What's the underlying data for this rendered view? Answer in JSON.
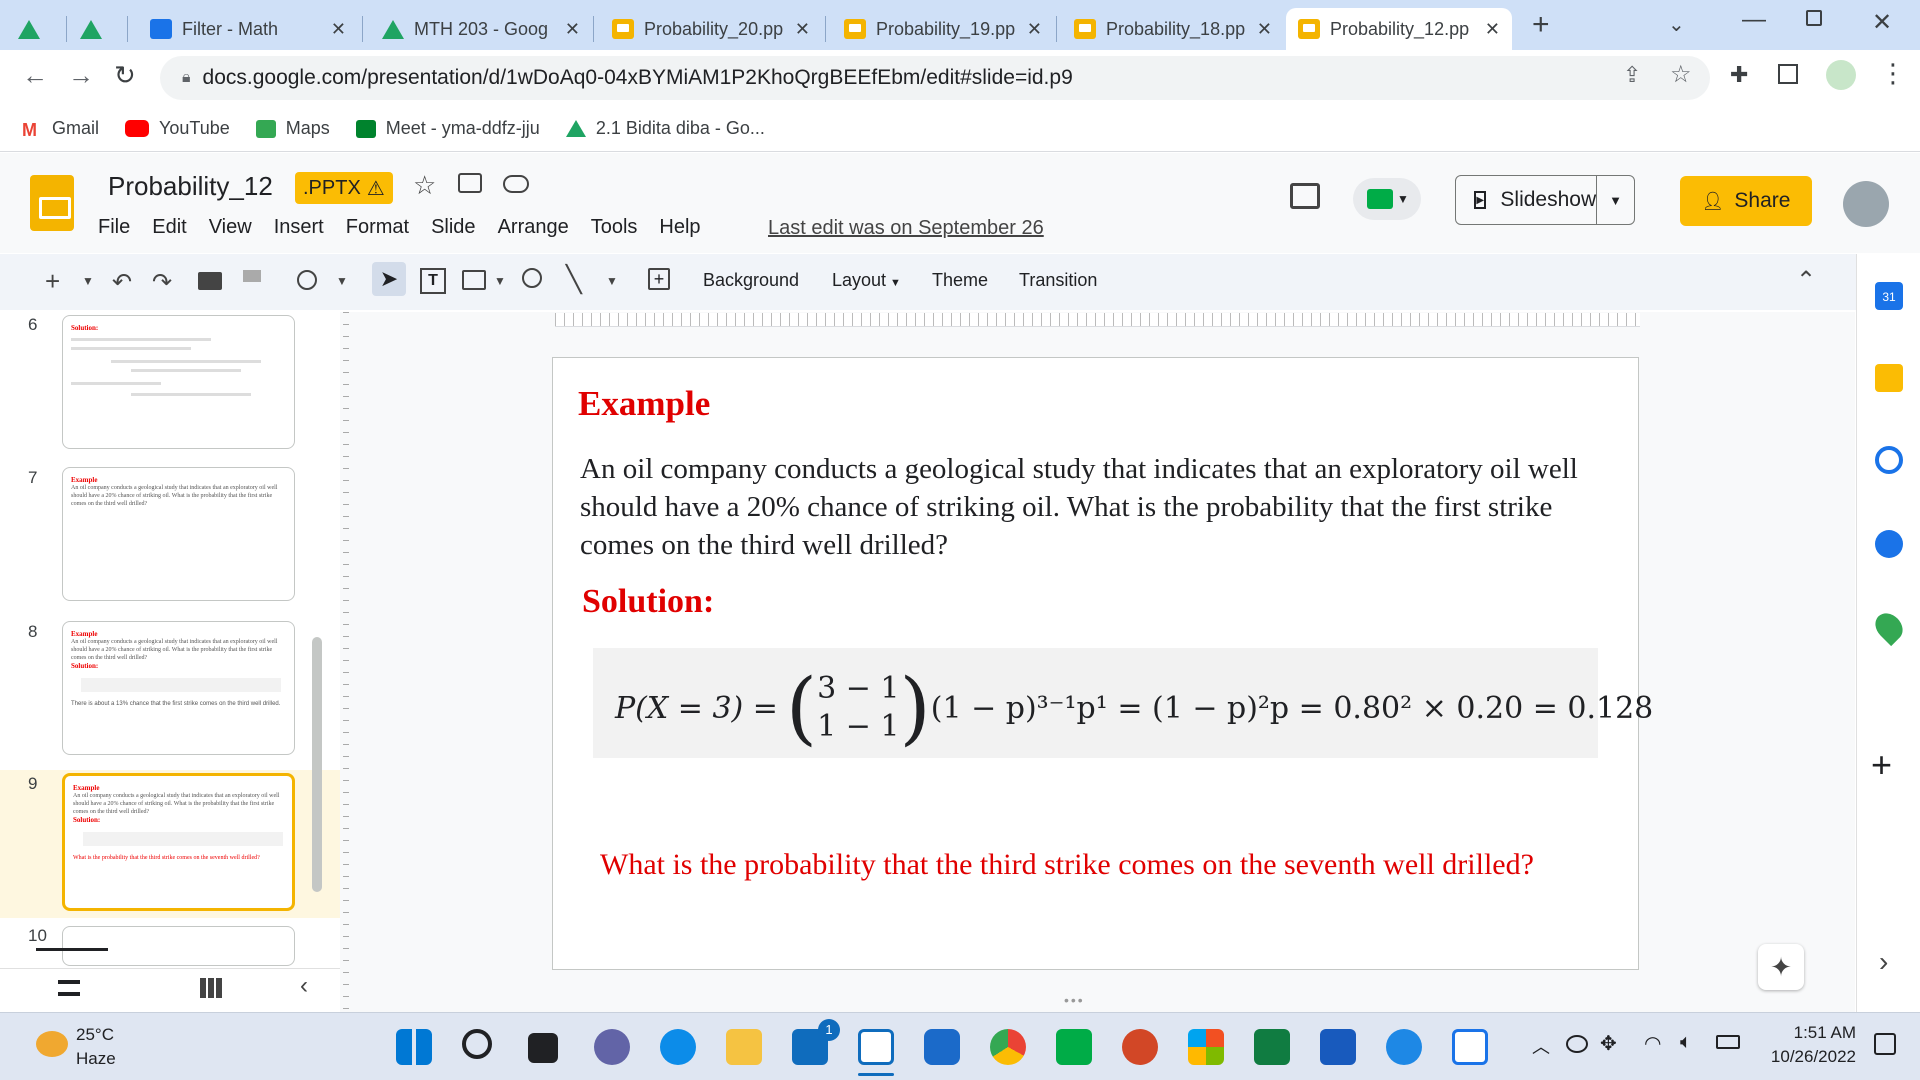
{
  "browser": {
    "tabs": [
      {
        "label": "",
        "icon": "drive-icon"
      },
      {
        "label": "",
        "icon": "drive-icon"
      },
      {
        "label": "Filter - Math",
        "icon": "classroom-icon"
      },
      {
        "label": "MTH 203 - Goog",
        "icon": "drive-icon"
      },
      {
        "label": "Probability_20.pp",
        "icon": "slides-icon"
      },
      {
        "label": "Probability_19.pp",
        "icon": "slides-icon"
      },
      {
        "label": "Probability_18.pp",
        "icon": "slides-icon"
      },
      {
        "label": "Probability_12.pp",
        "icon": "slides-icon"
      }
    ],
    "url": "docs.google.com/presentation/d/1wDoAq0-04xBYMiAM1P2KhoQrgBEEfEbm/edit#slide=id.p9",
    "bookmarks": [
      "Gmail",
      "YouTube",
      "Maps",
      "Meet - yma-ddfz-jju",
      "2.1 Bidita diba - Go..."
    ]
  },
  "doc": {
    "title": "Probability_12",
    "badge": ".PPTX",
    "menu": [
      "File",
      "Edit",
      "View",
      "Insert",
      "Format",
      "Slide",
      "Arrange",
      "Tools",
      "Help"
    ],
    "last_edit": "Last edit was on September 26",
    "slideshow_label": "Slideshow",
    "share_label": "Share"
  },
  "toolbar": {
    "background": "Background",
    "layout": "Layout",
    "theme": "Theme",
    "transition": "Transition"
  },
  "thumbnails": [
    {
      "num": "6",
      "heading": "Solution:",
      "text": ""
    },
    {
      "num": "7",
      "heading": "Example",
      "text": "An oil company conducts a geological study that indicates that an exploratory oil well should have a 20% chance of striking oil. What is the probability that the first strike comes on the third well drilled?"
    },
    {
      "num": "8",
      "heading": "Example",
      "text": "An oil company conducts a geological study that indicates that an exploratory oil well should have a 20% chance of striking oil. What is the probability that the first strike comes on the third well drilled?",
      "sol": "Solution:",
      "note": "There is about a 13% chance that the first strike comes on the third well drilled."
    },
    {
      "num": "9",
      "heading": "Example",
      "text": "An oil company conducts a geological study that indicates that an exploratory oil well should have a 20% chance of striking oil. What is the probability that the first strike comes on the third well drilled?",
      "sol": "Solution:",
      "note": "What is the probability that the third strike comes on the seventh well drilled?"
    },
    {
      "num": "10"
    }
  ],
  "slide": {
    "title": "Example",
    "body": "An oil company conducts a geological study that indicates that an exploratory oil well should have a 20% chance of striking oil. What is the probability that the first strike comes on the third well drilled?",
    "solution": "Solution:",
    "eq_lhs": "P(X = 3) =",
    "eq_binom_top": "3 − 1",
    "eq_binom_bottom": "1 − 1",
    "eq_rhs": "(1 − p)³⁻¹p¹ = (1 − p)²p = 0.80² × 0.20 = 0.128",
    "question": "What is the probability that the third strike comes on the seventh well drilled?"
  },
  "taskbar": {
    "weather_temp": "25°C",
    "weather_desc": "Haze",
    "time": "1:51 AM",
    "date": "10/26/2022",
    "badge_count": "1"
  },
  "colors": {
    "accent": "#fbbc04",
    "slide_red": "#e00000",
    "tabstrip": "#cfe0f7"
  }
}
